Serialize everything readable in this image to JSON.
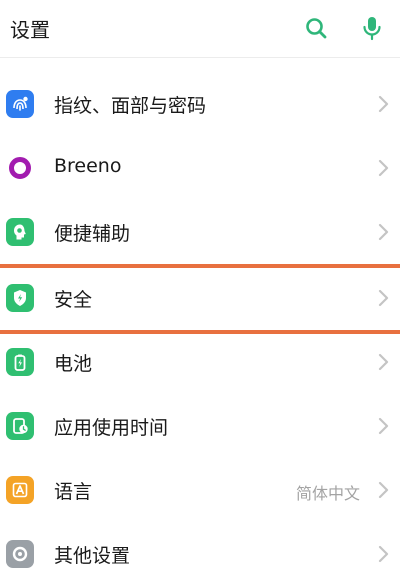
{
  "header": {
    "title": "设置"
  },
  "items": [
    {
      "label": "指纹、面部与密码",
      "value": ""
    },
    {
      "label": "Breeno",
      "value": ""
    },
    {
      "label": "便捷辅助",
      "value": ""
    },
    {
      "label": "安全",
      "value": ""
    },
    {
      "label": "电池",
      "value": ""
    },
    {
      "label": "应用使用时间",
      "value": ""
    },
    {
      "label": "语言",
      "value": "简体中文"
    },
    {
      "label": "其他设置",
      "value": ""
    }
  ],
  "icons": {
    "search": "search-icon",
    "voice": "microphone-icon",
    "chevron": "chevron-right-icon"
  },
  "colors": {
    "accent": "#2fb67a",
    "fingerprint": "#2f7df0",
    "breeno": "#a21caf",
    "green": "#2fbf71",
    "language": "#f4a326",
    "other": "#9aa0a6",
    "highlight": "#e8703f"
  }
}
